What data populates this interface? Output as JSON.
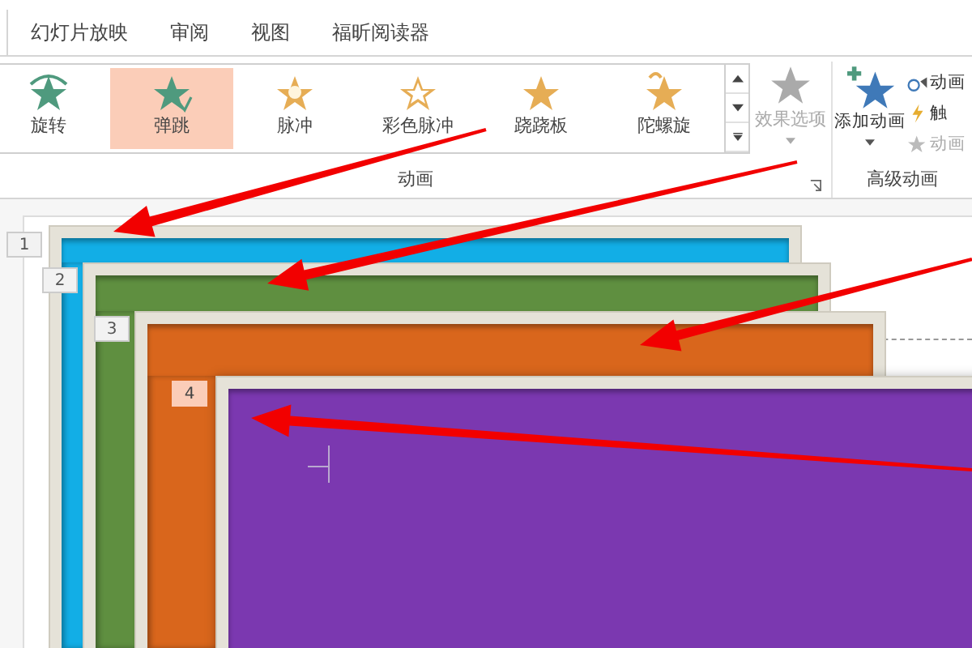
{
  "tabs": [
    {
      "label": "幻灯片放映",
      "selected": false
    },
    {
      "label": "审阅",
      "selected": false
    },
    {
      "label": "视图",
      "selected": false
    },
    {
      "label": "福昕阅读器",
      "selected": false
    }
  ],
  "animation_group": {
    "label": "动画",
    "gallery": [
      {
        "label": "旋转",
        "kind": "spin",
        "selected": false
      },
      {
        "label": "弹跳",
        "kind": "bounce",
        "selected": true
      },
      {
        "label": "脉冲",
        "kind": "pulse",
        "selected": false
      },
      {
        "label": "彩色脉冲",
        "kind": "color-pulse",
        "selected": false
      },
      {
        "label": "跷跷板",
        "kind": "teeter",
        "selected": false
      },
      {
        "label": "陀螺旋",
        "kind": "spinner",
        "selected": false
      }
    ],
    "effect_options": {
      "label": "效果选项",
      "disabled": true
    }
  },
  "advanced_group": {
    "label": "高级动画",
    "add_animation": "添加动画",
    "commands": [
      {
        "label": "动画",
        "kind": "pane",
        "disabled": false
      },
      {
        "label": "触",
        "kind": "trigger",
        "disabled": false
      },
      {
        "label": "动画",
        "kind": "painter",
        "disabled": true
      }
    ]
  },
  "slides": [
    {
      "number": "1",
      "selected": false,
      "color": "#12aee6"
    },
    {
      "number": "2",
      "selected": false,
      "color": "#5f8f40"
    },
    {
      "number": "3",
      "selected": false,
      "color": "#d9661c"
    },
    {
      "number": "4",
      "selected": true,
      "color": "#7b38b0"
    }
  ]
}
